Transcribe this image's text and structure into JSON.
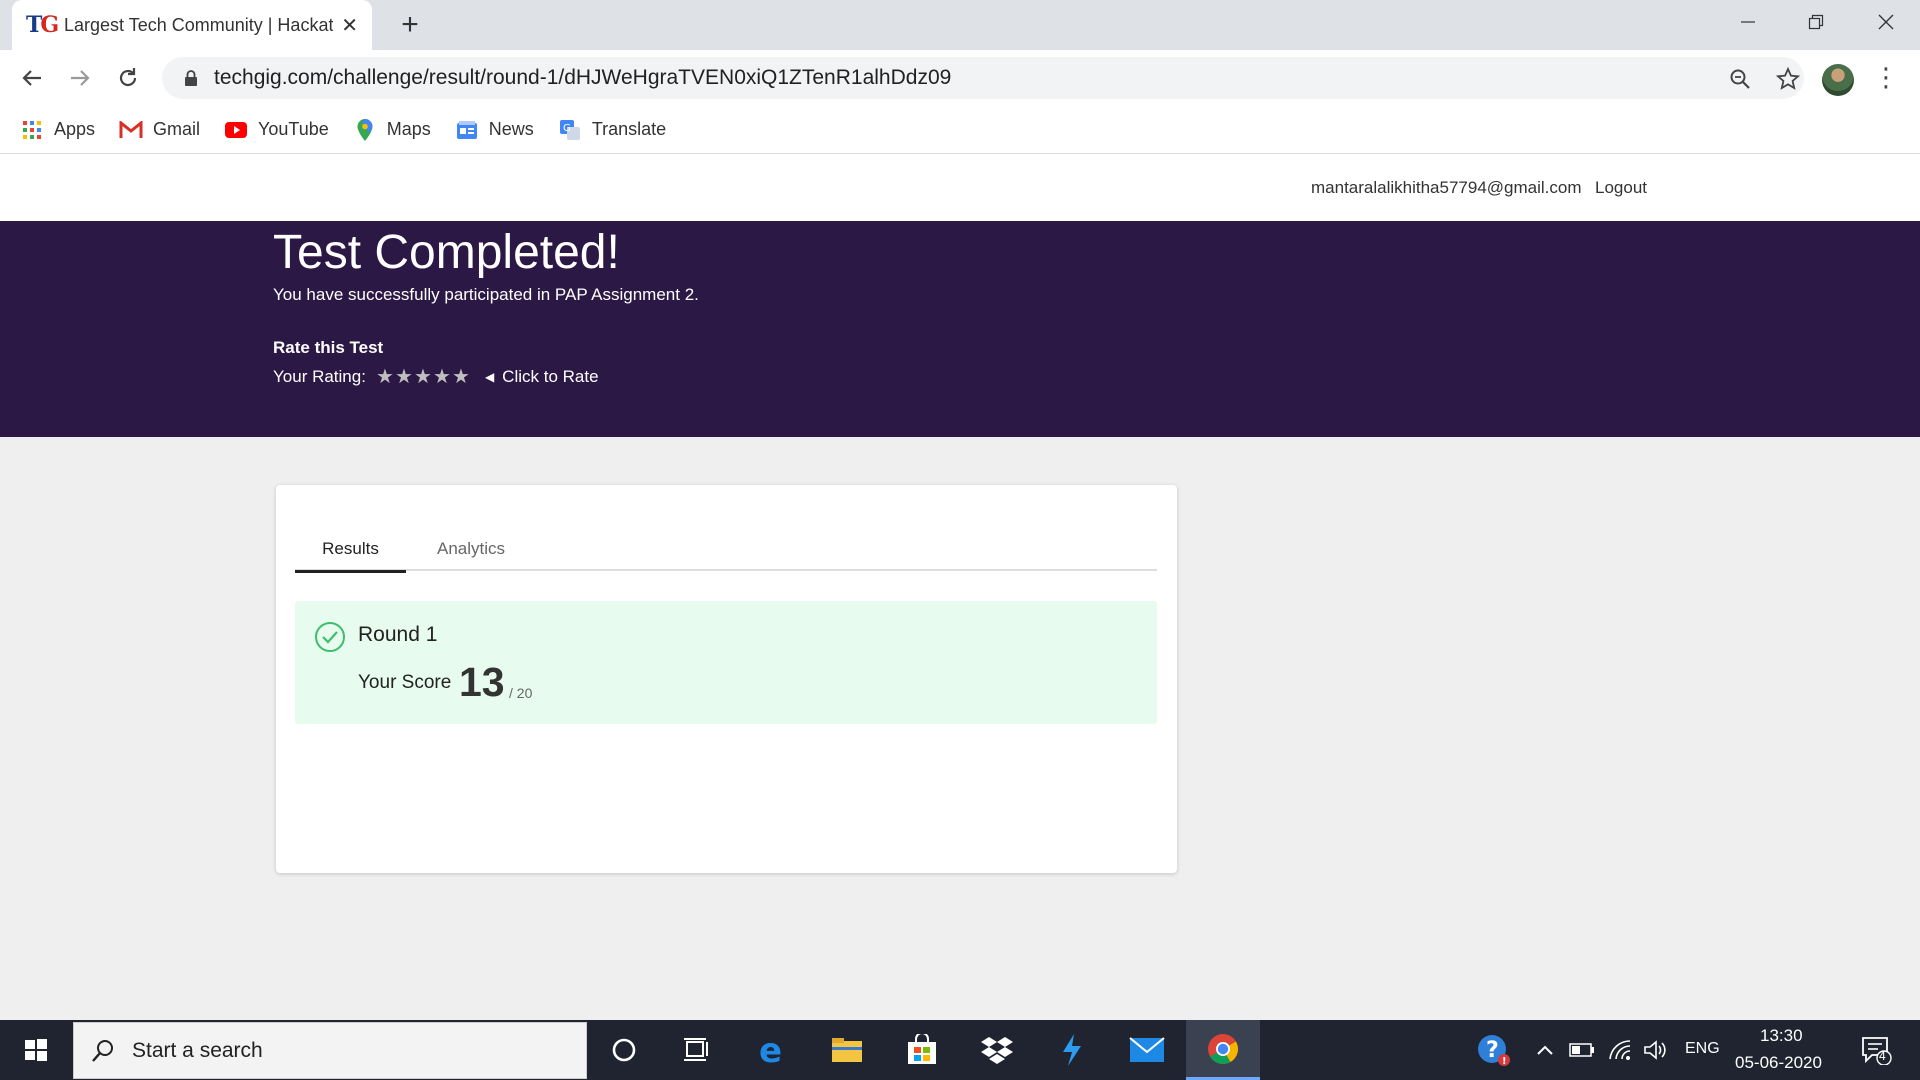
{
  "browser": {
    "tab_title": "Largest Tech Community | Hackat",
    "url": "techgig.com/challenge/result/round-1/dHJWeHgraTVEN0xiQ1ZTenR1alhDdz09",
    "bookmarks": [
      {
        "label": "Apps",
        "icon": "apps-grid-icon"
      },
      {
        "label": "Gmail",
        "icon": "gmail-icon"
      },
      {
        "label": "YouTube",
        "icon": "youtube-icon"
      },
      {
        "label": "Maps",
        "icon": "maps-pin-icon"
      },
      {
        "label": "News",
        "icon": "news-icon"
      },
      {
        "label": "Translate",
        "icon": "translate-icon"
      }
    ]
  },
  "header": {
    "email": "mantaralalikhitha57794@gmail.com",
    "logout": "Logout"
  },
  "banner": {
    "title": "Test Completed!",
    "subtitle": "You have successfully participated in PAP Assignment 2.",
    "rate_title": "Rate this Test",
    "rating_label": "Your Rating:",
    "rating_value": 0,
    "rating_max": 5,
    "click_to_rate": "Click to Rate"
  },
  "card": {
    "tabs": [
      {
        "label": "Results",
        "active": true
      },
      {
        "label": "Analytics",
        "active": false
      }
    ],
    "round": {
      "title": "Round 1",
      "score_label": "Your Score",
      "score": "13",
      "total": "/ 20"
    }
  },
  "taskbar": {
    "search_placeholder": "Start a search",
    "language": "ENG",
    "time": "13:30",
    "date": "05-06-2020",
    "notification_count": "4"
  },
  "colors": {
    "banner_bg": "#2c1845",
    "result_bg": "#e8fbef",
    "check_green": "#3cbf6b"
  }
}
